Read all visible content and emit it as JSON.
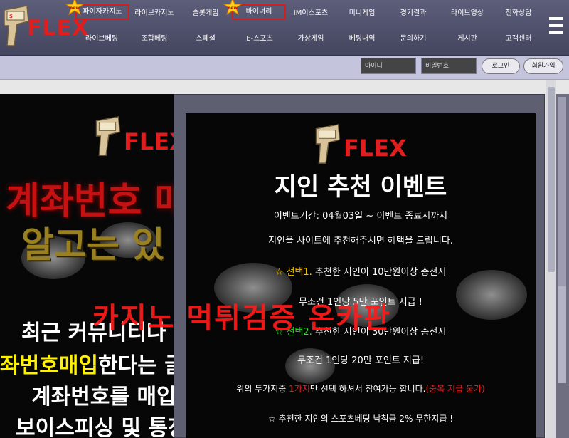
{
  "brand": {
    "logo_text": "FLEX",
    "accent": "#e11d1d"
  },
  "nav": {
    "row1": [
      "파이자카지노",
      "라이브카지노",
      "슬롯게임",
      "바이너리",
      "IM이스포츠",
      "미니게임",
      "경기결과",
      "라이브영상",
      "전화상담"
    ],
    "row2": [
      "라이브베팅",
      "조합베팅",
      "스페셜",
      "E-스포츠",
      "가상게임",
      "베팅내역",
      "문의하기",
      "게시판",
      "고객센터"
    ],
    "highlighted": [
      "파이자카지노",
      "바이너리"
    ],
    "new_badge": "new",
    "menu_icon": "hamburger-menu-icon"
  },
  "login": {
    "id_placeholder": "아이디",
    "pw_placeholder": "비밀번호",
    "login_label": "로그인",
    "signup_label": "회원가입"
  },
  "popup_left": {
    "logo_text": "FLEX",
    "headline_red": "계좌번호 매입",
    "headline_gold": "알고는 있",
    "lines": [
      {
        "text": "최근 커뮤니티나 인터"
      },
      {
        "highlight": "좌번호매입",
        "text": "한다는 글들"
      },
      {
        "text": "계좌번호를 매입하"
      },
      {
        "text": "보이스피싱 및 통장협"
      }
    ]
  },
  "popup_center": {
    "logo_text": "FLEX",
    "title": "지인 추천 이벤트",
    "period": "이벤트기간: 04월03일 ~ 이벤트 종료시까지",
    "intro": "지인을 사이트에 추천해주시면 혜택을 드립니다.",
    "option1_label": "☆ 선택1.",
    "option1_text": "추천한 지인이 10만원이상 충전시",
    "option1_reward": "무조건 1인당 5만 포인트 지급 !",
    "option2_label": "☆ 선택2.",
    "option2_text": "추천한 지인이 30만원이상 충전시",
    "option2_reward": "무조건 1인당 20만 포인트 지급!",
    "note_prefix": "위의 두가지중",
    "note_red": "1가지",
    "note_mid": "만 선택 하셔서 참여가능 합니다.",
    "note_red2": "(중복 지급 불가)",
    "bonus": "☆ 추천한 지인의 스포츠베팅 낙첨금 2% 무한지급 !"
  },
  "watermark": "카지노 먹튀검증 온카판"
}
